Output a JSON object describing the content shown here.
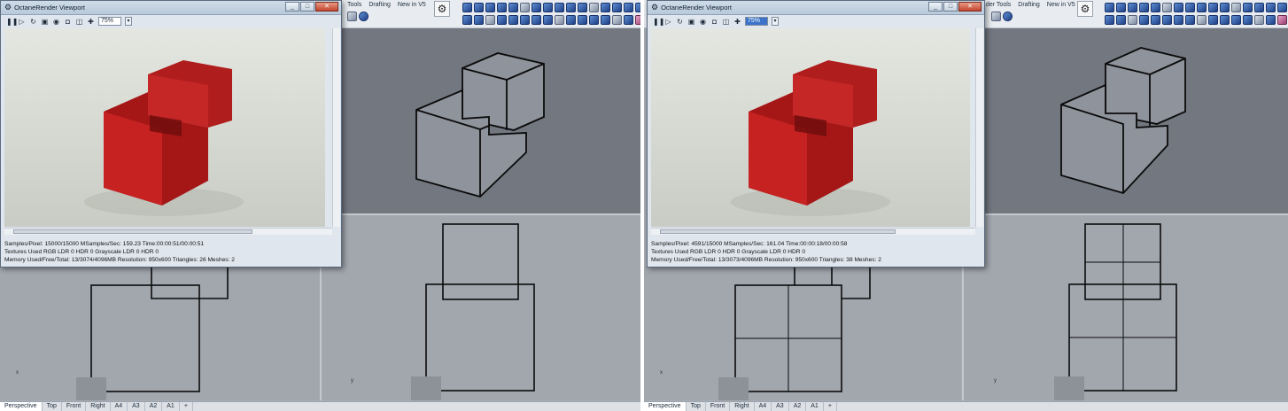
{
  "left": {
    "octane": {
      "title": "OctaneRender Viewport",
      "zoom": "75%",
      "stats": {
        "line1": "Samples/Pixel: 15000/15000  MSamples/Sec: 159.23  Time:00:00:51/00:00:51",
        "line2": "Textures Used RGB LDR 0   HDR 0   Grayscale LDR 0   HDR 0",
        "line3": "Memory Used/Free/Total: 13/3074/4096MB  Resolution: 950x600  Triangles: 26  Meshes:  2"
      }
    },
    "toolbar_tabs": [
      "Tools",
      "Drafting",
      "New in V5"
    ],
    "viewport_tabs": [
      "Perspective",
      "Top",
      "Front",
      "Right",
      "A4",
      "A3",
      "A2",
      "A1",
      "+"
    ],
    "axis_labels": {
      "top_left": "x",
      "top_right": "y"
    }
  },
  "right": {
    "octane": {
      "title": "OctaneRender Viewport",
      "zoom": "75%",
      "stats": {
        "line1": "Samples/Pixel: 4591/15000  MSamples/Sec: 161.04  Time:00:00:18/00:00:58",
        "line2": "Textures Used RGB LDR 0   HDR 0   Grayscale LDR 0   HDR 0",
        "line3": "Memory Used/Free/Total: 13/3073/4096MB  Resolution: 950x600  Triangles: 38  Meshes:  2"
      }
    },
    "toolbar_tabs": [
      "der Tools",
      "Drafting",
      "New in V5"
    ],
    "viewport_tabs": [
      "Perspective",
      "Top",
      "Front",
      "Right",
      "A4",
      "A3",
      "A2",
      "A1",
      "+"
    ],
    "axis_labels": {
      "top_left": "x",
      "top_right": "y"
    }
  },
  "colors": {
    "cube_red": "#a81818",
    "viewport_dark": "#737780",
    "viewport_light": "#a2a7ae",
    "window_frame": "#dfe6ee"
  },
  "icons": [
    "gear-icon",
    "pause-icon",
    "play-icon",
    "refresh-icon",
    "lock-icon",
    "help-icon",
    "close-icon",
    "minimize-icon",
    "maximize-icon"
  ]
}
